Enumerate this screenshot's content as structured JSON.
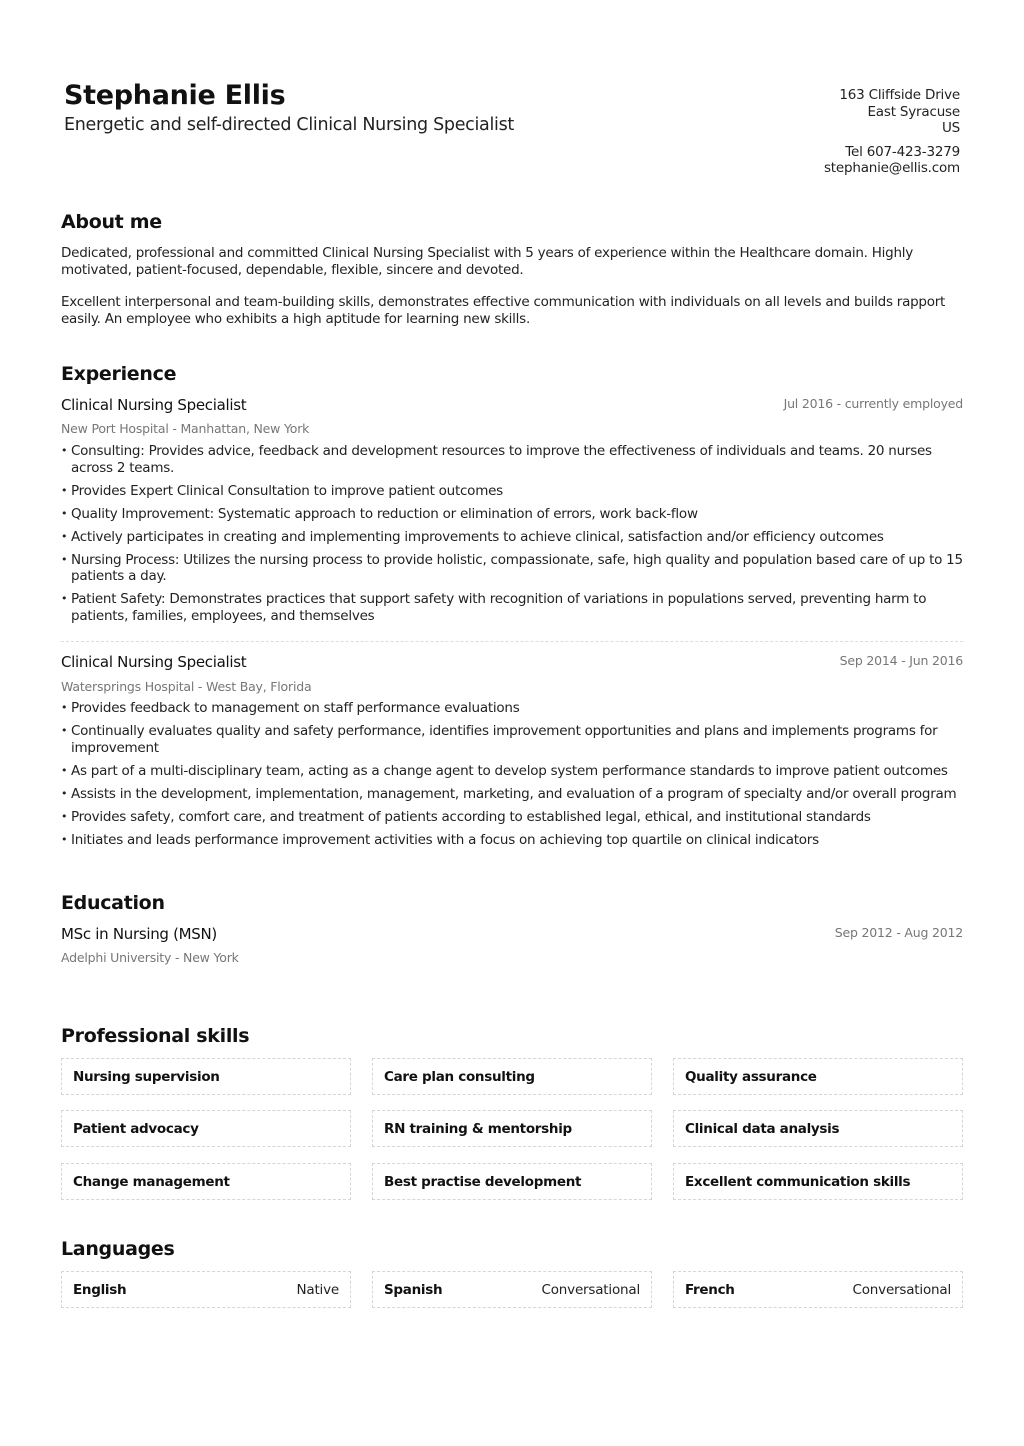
{
  "header": {
    "name": "Stephanie Ellis",
    "tagline": "Energetic and self-directed Clinical Nursing Specialist",
    "address": [
      "163 Cliffside Drive",
      "East Syracuse",
      "US"
    ],
    "phone": "Tel 607-423-3279",
    "email": "stephanie@ellis.com"
  },
  "about": {
    "title": "About me",
    "paragraphs": [
      "Dedicated, professional and committed Clinical Nursing Specialist with 5 years of experience within the Healthcare domain. Highly motivated, patient-focused, dependable, flexible, sincere and devoted.",
      "Excellent interpersonal and team-building skills, demonstrates effective communication with individuals on all levels and builds rapport easily. An employee who exhibits a high aptitude for learning new skills."
    ]
  },
  "experience": {
    "title": "Experience",
    "jobs": [
      {
        "title": "Clinical Nursing Specialist",
        "dates": "Jul 2016 - currently employed",
        "org": "New Port Hospital - Manhattan, New York",
        "bullets": [
          "Consulting: Provides advice, feedback and development resources to improve the effectiveness of individuals and teams. 20 nurses across 2 teams.",
          "Provides Expert Clinical Consultation to improve patient outcomes",
          "Quality Improvement: Systematic approach to reduction or elimination of errors, work back-flow",
          "Actively participates in creating and implementing improvements to achieve clinical, satisfaction and/or efficiency outcomes",
          "Nursing Process: Utilizes the nursing process to provide holistic, compassionate, safe, high quality and population based care of up to 15 patients a day.",
          "Patient Safety: Demonstrates practices that support safety with recognition of variations in populations served, preventing harm to patients, families, employees, and themselves"
        ]
      },
      {
        "title": "Clinical Nursing Specialist",
        "dates": "Sep 2014 - Jun 2016",
        "org": "Watersprings Hospital - West Bay, Florida",
        "bullets": [
          "Provides feedback to management on staff performance evaluations",
          "Continually evaluates quality and safety performance, identifies improvement opportunities and plans and implements programs for improvement",
          "As part of a multi-disciplinary team, acting as a change agent to develop system performance standards to improve patient outcomes",
          "Assists in the development, implementation, management, marketing, and evaluation of a program of specialty and/or overall program",
          "Provides safety, comfort care, and treatment of patients according to established legal, ethical, and institutional standards",
          "Initiates and leads performance improvement activities with a focus on achieving top quartile on clinical indicators"
        ]
      }
    ]
  },
  "education": {
    "title": "Education",
    "items": [
      {
        "degree": "MSc in Nursing (MSN)",
        "dates": "Sep 2012 - Aug 2012",
        "school": "Adelphi University - New York"
      }
    ]
  },
  "skills": {
    "title": "Professional skills",
    "items": [
      "Nursing supervision",
      "Care plan consulting",
      "Quality assurance",
      "Patient advocacy",
      "RN training & mentorship",
      "Clinical data analysis",
      "Change management",
      "Best practise development",
      "Excellent communication skills"
    ]
  },
  "languages": {
    "title": "Languages",
    "items": [
      {
        "name": "English",
        "level": "Native"
      },
      {
        "name": "Spanish",
        "level": "Conversational"
      },
      {
        "name": "French",
        "level": "Conversational"
      }
    ]
  }
}
